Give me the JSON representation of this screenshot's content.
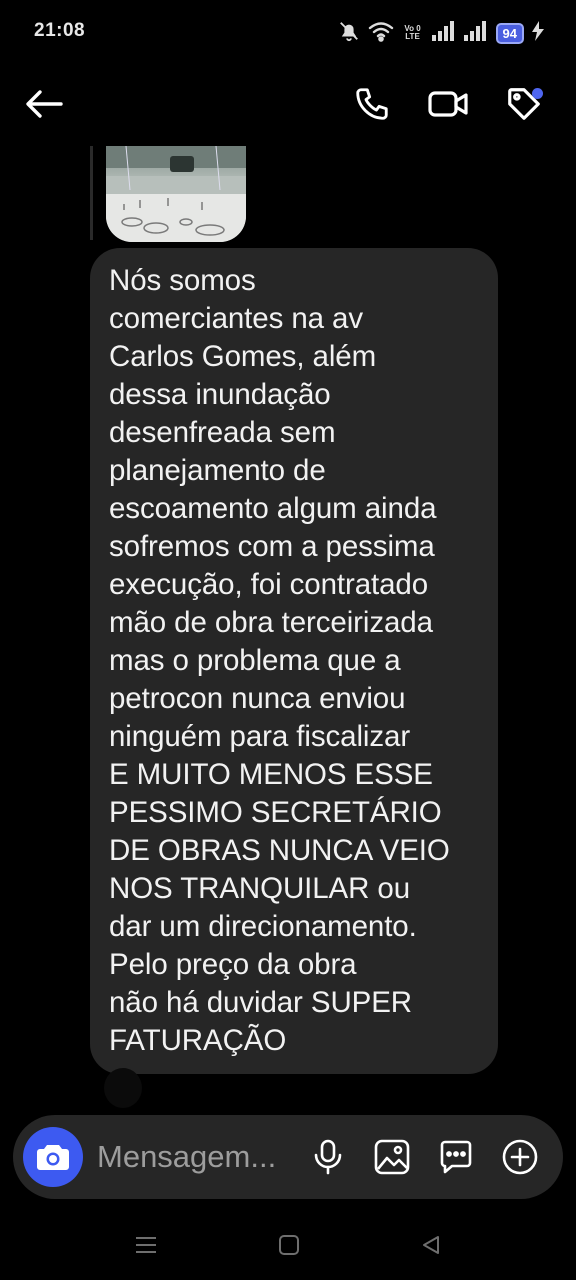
{
  "status_bar": {
    "time": "21:08",
    "network_label_top": "Vo 0",
    "network_label_bottom": "LTE",
    "battery_level": "94"
  },
  "header": {
    "icons": [
      "back-arrow-icon",
      "phone-icon",
      "video-camera-icon",
      "tag-icon"
    ],
    "notification_dot_color": "#4f66f0"
  },
  "message": {
    "text": "Nós somos\ncomerciantes na av\nCarlos Gomes, além\ndessa inundação\ndesenfreada sem\nplanejamento de\nescoamento algum ainda\nsofremos com a pessima\nexecução, foi contratado\nmão de obra terceirizada\nmas o problema que a\npetrocon nunca enviou\nninguém para fiscalizar\nE MUITO MENOS ESSE\nPESSIMO SECRETÁRIO\nDE OBRAS NUNCA VEIO\nNOS TRANQUILAR ou\ndar um direcionamento.\nPelo preço da obra\nnão há duvidar SUPER\nFATURAÇÃO",
    "bubble_color": "#262626"
  },
  "composer": {
    "placeholder": "Mensagem...",
    "camera_color": "#3d5af1",
    "icons": [
      "camera-icon",
      "microphone-icon",
      "gallery-icon",
      "sticker-icon",
      "plus-icon"
    ]
  },
  "navbar": {
    "icons": [
      "menu-icon",
      "home-icon",
      "back-triangle-icon"
    ]
  }
}
